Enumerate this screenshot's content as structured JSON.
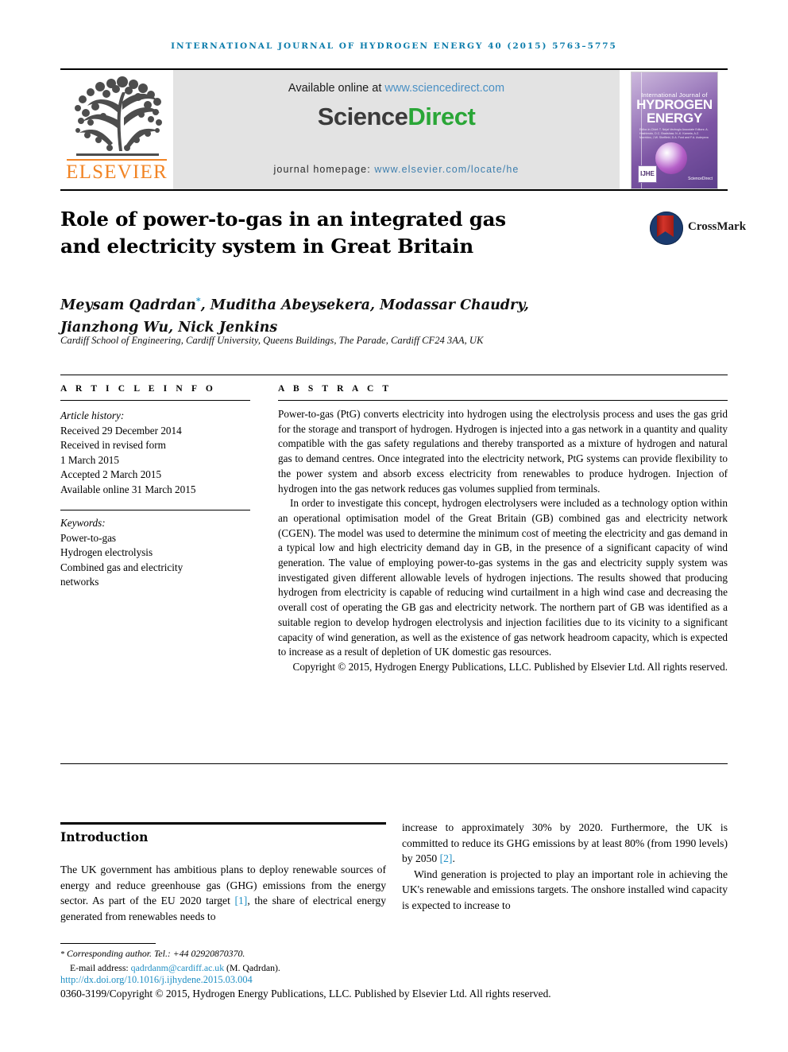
{
  "running_head": "International Journal of Hydrogen Energy 40 (2015) 5763–5775",
  "masthead": {
    "publisher": "ELSEVIER",
    "available_online": "Available online at ",
    "available_online_url": "www.sciencedirect.com",
    "sciencedirect_part1": "Science",
    "sciencedirect_part2": "Direct",
    "journal_homepage_label": "journal homepage: ",
    "journal_homepage_url": "www.elsevier.com/locate/he",
    "cover": {
      "line_small": "International Journal of",
      "line1": "HYDROGEN",
      "line2": "ENERGY",
      "editors": "Editor-in-Chief:  T. Nejat Veziroglu    Associate Editors:  A. Hashimoto, D.C. Bradshaw, N.-K. Kameta, A.Z. Mavridou, J.W. Sheffield, D.A. Ford and F.A. Avdeyeva",
      "badge": "IJHE",
      "sciencedirect_mark": "ScienceDirect"
    }
  },
  "article": {
    "title_line1": "Role of power-to-gas in an integrated gas",
    "title_line2": "and electricity system in Great Britain",
    "crossmark_label": "CrossMark",
    "authors_line1": "Meysam Qadrdan",
    "authors_star": "*",
    "authors_line1_rest": ", Muditha Abeysekera, Modassar Chaudry,",
    "authors_line2": "Jianzhong Wu, Nick Jenkins",
    "affiliation": "Cardiff School of Engineering, Cardiff University, Queens Buildings, The Parade, Cardiff CF24 3AA, UK"
  },
  "info": {
    "article_info_header": "A R T I C L E   I N F O",
    "abstract_header": "A B S T R A C T",
    "history_label": "Article history:",
    "history": [
      "Received 29 December 2014",
      "Received in revised form",
      "1 March 2015",
      "Accepted 2 March 2015",
      "Available online 31 March 2015"
    ],
    "keywords_label": "Keywords:",
    "keywords": [
      "Power-to-gas",
      "Hydrogen electrolysis",
      "Combined gas and electricity",
      "networks"
    ]
  },
  "abstract": {
    "p1": "Power-to-gas (PtG) converts electricity into hydrogen using the electrolysis process and uses the gas grid for the storage and transport of hydrogen. Hydrogen is injected into a gas network in a quantity and quality compatible with the gas safety regulations and thereby transported as a mixture of hydrogen and natural gas to demand centres. Once integrated into the electricity network, PtG systems can provide flexibility to the power system and absorb excess electricity from renewables to produce hydrogen. Injection of hydrogen into the gas network reduces gas volumes supplied from terminals.",
    "p2": "In order to investigate this concept, hydrogen electrolysers were included as a technology option within an operational optimisation model of the Great Britain (GB) combined gas and electricity network (CGEN). The model was used to determine the minimum cost of meeting the electricity and gas demand in a typical low and high electricity demand day in GB, in the presence of a significant capacity of wind generation. The value of employing power-to-gas systems in the gas and electricity supply system was investigated given different allowable levels of hydrogen injections. The results showed that producing hydrogen from electricity is capable of reducing wind curtailment in a high wind case and decreasing the overall cost of operating the GB gas and electricity network. The northern part of GB was identified as a suitable region to develop hydrogen electrolysis and injection facilities due to its vicinity to a significant capacity of wind generation, as well as the existence of gas network headroom capacity, which is expected to increase as a result of depletion of UK domestic gas resources.",
    "copyright": "Copyright © 2015, Hydrogen Energy Publications, LLC. Published by Elsevier Ltd. All rights reserved."
  },
  "body": {
    "intro_heading": "Introduction",
    "left_p1_a": "The UK government has ambitious plans to deploy renewable sources of energy and reduce greenhouse gas (GHG) emissions from the energy sector. As part of the EU 2020 target ",
    "left_ref1": "[1]",
    "left_p1_b": ", the share of electrical energy generated from renewables needs to",
    "right_p1_a": "increase to approximately 30% by 2020. Furthermore, the UK is committed to reduce its GHG emissions by at least 80% (from 1990 levels) by 2050 ",
    "right_ref2": "[2]",
    "right_p1_b": ".",
    "right_p2": "Wind generation is projected to play an important role in achieving the UK's renewable and emissions targets. The onshore installed wind capacity is expected to increase to"
  },
  "footer": {
    "corresponding_star": "*",
    "corresponding_author": " Corresponding author. Tel.: +44 02920870370.",
    "email_label": "E-mail address: ",
    "email": "qadrdanm@cardiff.ac.uk",
    "email_suffix": " (M. Qadrdan).",
    "doi": "http://dx.doi.org/10.1016/j.ijhydene.2015.03.004",
    "issn_line": "0360-3199/Copyright © 2015, Hydrogen Energy Publications, LLC. Published by Elsevier Ltd. All rights reserved."
  }
}
